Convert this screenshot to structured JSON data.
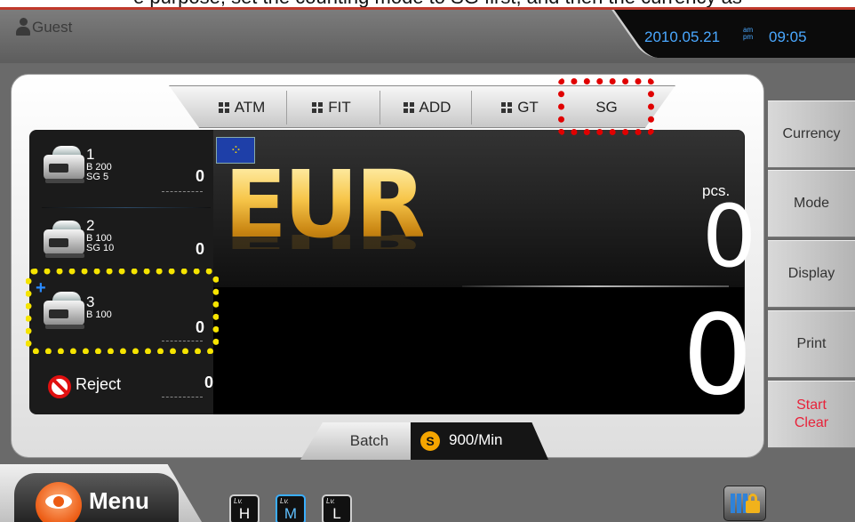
{
  "caption": {
    "text": "e purpose, set the counting mode to SG first, and then the currency as"
  },
  "header": {
    "user": "Guest",
    "date": "2010.05.21",
    "ampm": [
      "am",
      "pm"
    ],
    "time": "09:05"
  },
  "modes": {
    "tabs": [
      {
        "label": "ATM"
      },
      {
        "label": "FIT"
      },
      {
        "label": "ADD"
      },
      {
        "label": "GT"
      },
      {
        "label": "SG"
      }
    ],
    "selected": "SG"
  },
  "pockets": [
    {
      "number": "1",
      "lines": [
        "B 200",
        "SG 5"
      ],
      "count": "0"
    },
    {
      "number": "2",
      "lines": [
        "B 100",
        "SG 10"
      ],
      "count": "0"
    },
    {
      "number": "3",
      "lines": [
        "B 100"
      ],
      "count": "0"
    }
  ],
  "reject": {
    "label": "Reject",
    "count": "0"
  },
  "display": {
    "currency": "EUR",
    "pcs_label": "pcs.",
    "pcs_value": "0",
    "total_value": "0"
  },
  "side_buttons": {
    "currency": "Currency",
    "mode": "Mode",
    "display": "Display",
    "print": "Print",
    "start": "Start",
    "clear": "Clear"
  },
  "status": {
    "batch": "Batch",
    "speed_icon": "S",
    "speed": "900/Min"
  },
  "menu": {
    "label": "Menu"
  },
  "levels": {
    "prefix": "Lv.",
    "items": [
      {
        "letter": "H"
      },
      {
        "letter": "M"
      },
      {
        "letter": "L"
      }
    ],
    "active": "M"
  },
  "colors": {
    "accent_blue": "#4aa8ff",
    "currency_gold": "#f6b21b",
    "highlight_red": "#e00000",
    "highlight_yellow": "#f6e400",
    "start_clear_red": "#e8223a"
  }
}
